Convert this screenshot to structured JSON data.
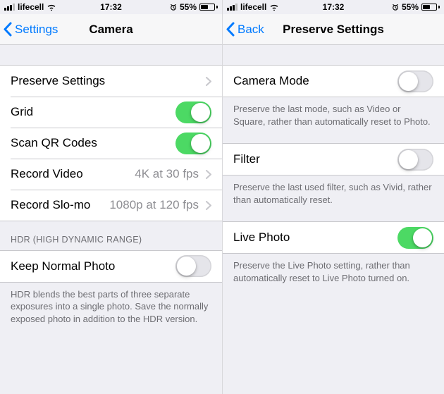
{
  "left": {
    "status": {
      "carrier": "lifecell",
      "time": "17:32",
      "battery_pct": "55%"
    },
    "nav": {
      "back": "Settings",
      "title": "Camera"
    },
    "rows": {
      "preserve": "Preserve Settings",
      "grid": "Grid",
      "scanqr": "Scan QR Codes",
      "recvideo_label": "Record Video",
      "recvideo_value": "4K at 30 fps",
      "recslomo_label": "Record Slo-mo",
      "recslomo_value": "1080p at 120 fps"
    },
    "hdr": {
      "header": "HDR (HIGH DYNAMIC RANGE)",
      "keep_label": "Keep Normal Photo",
      "footer": "HDR blends the best parts of three separate exposures into a single photo. Save the normally exposed photo in addition to the HDR version."
    }
  },
  "right": {
    "status": {
      "carrier": "lifecell",
      "time": "17:32",
      "battery_pct": "55%"
    },
    "nav": {
      "back": "Back",
      "title": "Preserve Settings"
    },
    "camera_mode": {
      "label": "Camera Mode",
      "footer": "Preserve the last mode, such as Video or Square, rather than automatically reset to Photo."
    },
    "filter": {
      "label": "Filter",
      "footer": "Preserve the last used filter, such as Vivid, rather than automatically reset."
    },
    "live_photo": {
      "label": "Live Photo",
      "footer": "Preserve the Live Photo setting, rather than automatically reset to Live Photo turned on."
    }
  }
}
